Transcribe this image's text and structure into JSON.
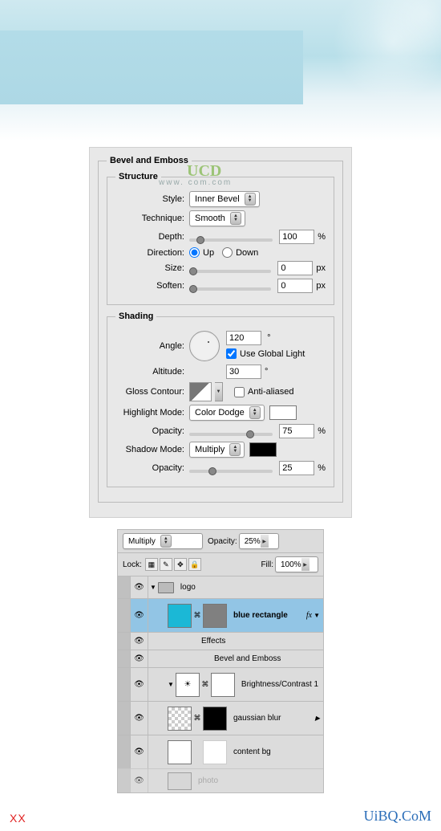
{
  "hero": {},
  "dialog": {
    "title": "Bevel and Emboss",
    "structure": {
      "legend": "Structure",
      "style_label": "Style:",
      "style_value": "Inner Bevel",
      "technique_label": "Technique:",
      "technique_value": "Smooth",
      "depth_label": "Depth:",
      "depth_value": "100",
      "depth_unit": "%",
      "direction_label": "Direction:",
      "dir_up": "Up",
      "dir_down": "Down",
      "size_label": "Size:",
      "size_value": "0",
      "size_unit": "px",
      "soften_label": "Soften:",
      "soften_value": "0",
      "soften_unit": "px"
    },
    "shading": {
      "legend": "Shading",
      "angle_label": "Angle:",
      "angle_value": "120",
      "angle_unit": "°",
      "use_global": "Use Global Light",
      "use_global_checked": true,
      "altitude_label": "Altitude:",
      "altitude_value": "30",
      "altitude_unit": "°",
      "gloss_label": "Gloss Contour:",
      "antialiased": "Anti-aliased",
      "antialiased_checked": false,
      "highlight_label": "Highlight Mode:",
      "highlight_value": "Color Dodge",
      "highlight_color": "#ffffff",
      "hi_opacity_label": "Opacity:",
      "hi_opacity_value": "75",
      "hi_opacity_unit": "%",
      "shadow_label": "Shadow Mode:",
      "shadow_value": "Multiply",
      "shadow_color": "#000000",
      "sh_opacity_label": "Opacity:",
      "sh_opacity_value": "25",
      "sh_opacity_unit": "%"
    },
    "watermark": "UCD",
    "watermark_sub": "www.                      com.com"
  },
  "layers": {
    "blend_value": "Multiply",
    "opacity_label": "Opacity:",
    "opacity_value": "25%",
    "lock_label": "Lock:",
    "fill_label": "Fill:",
    "fill_value": "100%",
    "rows": [
      {
        "name": "logo",
        "type": "group",
        "eye": true
      },
      {
        "name": "blue rectangle",
        "type": "layer",
        "eye": true,
        "selected": true,
        "fx": true,
        "thumb_fill": "#1bb8d6",
        "mask_fill": "#808080",
        "bold": true
      },
      {
        "name": "Effects",
        "type": "fx-parent"
      },
      {
        "name": "Bevel and Emboss",
        "type": "fx-child",
        "eye": true
      },
      {
        "name": "Brightness/Contrast 1",
        "type": "adj",
        "eye": true,
        "thumb_icon": "*",
        "mask_fill": "#ffffff"
      },
      {
        "name": "gaussian blur",
        "type": "layer",
        "eye": true,
        "fx": true,
        "thumb_fill": "checker",
        "mask_fill": "#000000"
      },
      {
        "name": "content bg",
        "type": "layer",
        "eye": true,
        "thumb_fill": "#ffffff"
      },
      {
        "name": "photo",
        "type": "layer",
        "eye": true,
        "dim": true,
        "thumb_fill": "#d4d4d4"
      }
    ]
  },
  "footer": {
    "xx": "XX",
    "brand": "UiBQ.CoM"
  }
}
